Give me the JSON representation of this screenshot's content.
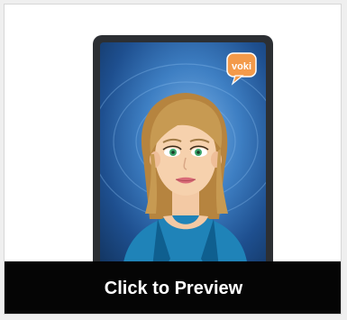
{
  "card": {
    "preview_label": "Click to Preview",
    "badge_text": "voki"
  },
  "colors": {
    "preview_bar": "#050505",
    "badge": "#f39a4a",
    "screen_glow": "#7fb4e8",
    "hair": "#c79a52",
    "top": "#1f83b8"
  },
  "icons": {
    "badge": "speech-bubble-icon"
  }
}
